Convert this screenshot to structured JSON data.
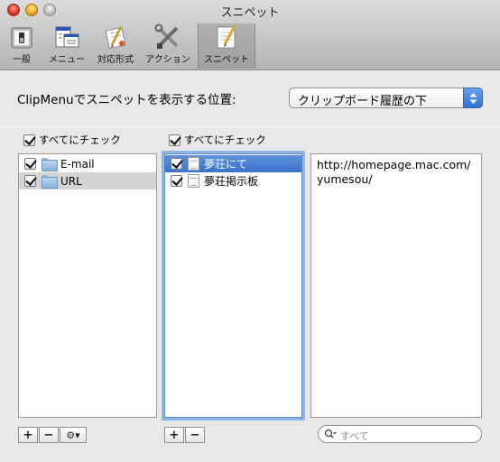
{
  "window": {
    "title": "スニペット"
  },
  "toolbar": {
    "items": [
      {
        "label": "一般",
        "icon": "general-switch-icon"
      },
      {
        "label": "メニュー",
        "icon": "menu-icon"
      },
      {
        "label": "対応形式",
        "icon": "formats-icon"
      },
      {
        "label": "アクション",
        "icon": "tools-icon"
      },
      {
        "label": "スニペット",
        "icon": "snippet-icon",
        "selected": true
      }
    ]
  },
  "position": {
    "label": "ClipMenuでスニペットを表示する位置:",
    "selected": "クリップボード履歴の下"
  },
  "folders": {
    "check_all": "すべてにチェック",
    "items": [
      {
        "label": "E-mail",
        "checked": true
      },
      {
        "label": "URL",
        "checked": true,
        "selected": true
      }
    ]
  },
  "snippets": {
    "check_all": "すべてにチェック",
    "items": [
      {
        "label": "夢荘にて",
        "checked": true,
        "selected": true
      },
      {
        "label": "夢荘掲示板",
        "checked": true
      }
    ]
  },
  "content": {
    "text": "http://homepage.mac.com/\nyumesou/"
  },
  "buttons": {
    "add": "+",
    "remove": "−",
    "gear": "⚙▾"
  },
  "search": {
    "placeholder": "すべて"
  },
  "colors": {
    "selection_blue": "#3a72cf",
    "accent": "#2f6fd3"
  }
}
